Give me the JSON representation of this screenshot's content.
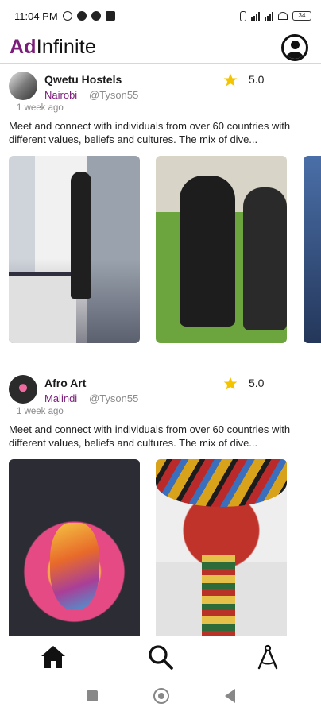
{
  "status": {
    "time": "11:04 PM",
    "battery": "34"
  },
  "app": {
    "title_prefix": "Ad",
    "title_suffix": "Infinite"
  },
  "posts": [
    {
      "title": "Qwetu Hostels",
      "rating": "5.0",
      "location": "Nairobi",
      "handle": "@Tyson55",
      "time": "1 week ago",
      "description": "Meet and connect with individuals from over 60 countries with different values, beliefs and cultures. The mix of dive..."
    },
    {
      "title": "Afro Art",
      "rating": "5.0",
      "location": "Malindi",
      "handle": "@Tyson55",
      "time": "1 week ago",
      "description": "Meet and connect with individuals from over 60 countries with different values, beliefs and cultures. The mix of dive..."
    }
  ],
  "icons": {
    "account": "account-circle-icon",
    "star": "star-icon",
    "home": "home-icon",
    "search": "search-icon",
    "tools": "compass-icon"
  },
  "colors": {
    "brand": "#7b1e7a",
    "star": "#f5c400"
  }
}
